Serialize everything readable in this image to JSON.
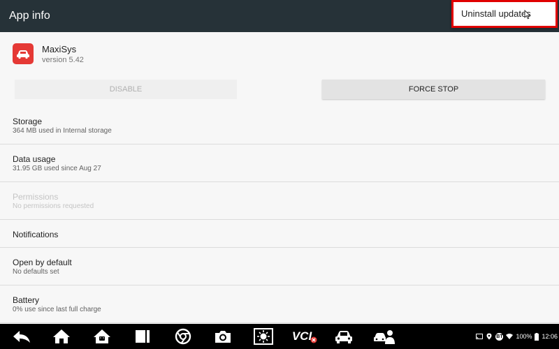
{
  "appbar": {
    "title": "App info"
  },
  "menu": {
    "uninstall_updates": "Uninstall updates"
  },
  "app": {
    "name": "MaxiSys",
    "version": "version 5.42"
  },
  "buttons": {
    "disable": "DISABLE",
    "force_stop": "FORCE STOP"
  },
  "settings": {
    "storage": {
      "title": "Storage",
      "summary": "364 MB used in Internal storage"
    },
    "data_usage": {
      "title": "Data usage",
      "summary": "31.95 GB used since Aug 27"
    },
    "permissions": {
      "title": "Permissions",
      "summary": "No permissions requested"
    },
    "notifications": {
      "title": "Notifications"
    },
    "open_by_default": {
      "title": "Open by default",
      "summary": "No defaults set"
    },
    "battery": {
      "title": "Battery",
      "summary": "0% use since last full charge"
    }
  },
  "navbar": {
    "items": [
      "back-icon",
      "home-icon",
      "android-icon",
      "recents-icon",
      "browser-icon",
      "camera-icon",
      "brightness-icon",
      "vci-icon",
      "car-icon",
      "service-person-icon"
    ],
    "vci_label": "VCI"
  },
  "status": {
    "battery": "100%",
    "time": "12:06",
    "bt_label": "BT"
  },
  "colors": {
    "appbar": "#263238",
    "highlight_border": "#e00000",
    "app_icon": "#e53935"
  }
}
